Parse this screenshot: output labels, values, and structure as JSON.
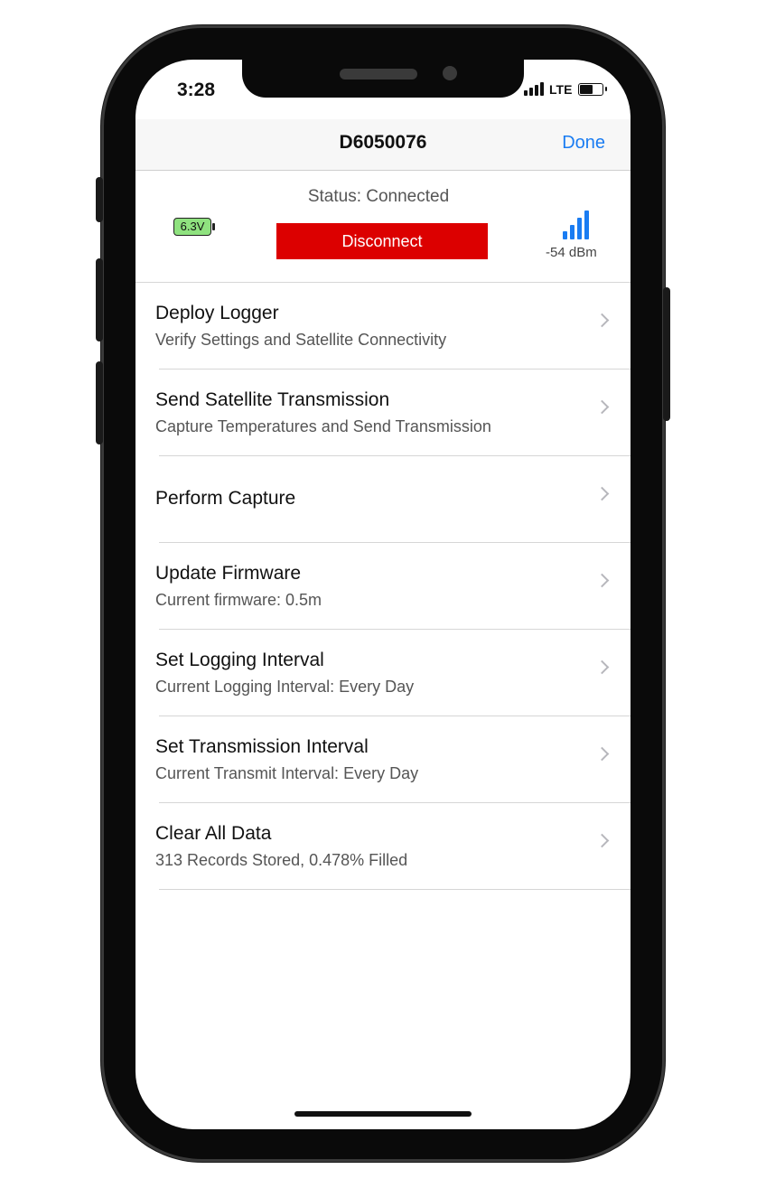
{
  "status_bar": {
    "time": "3:28",
    "network": "LTE",
    "phone_battery_level": 0.65
  },
  "nav": {
    "title": "D6050076",
    "done_label": "Done"
  },
  "device": {
    "status_text": "Status: Connected",
    "battery_label": "6.3V",
    "disconnect_label": "Disconnect",
    "signal_strength": "-54 dBm",
    "signal_icon": "signal-bars-icon"
  },
  "menu": [
    {
      "title": "Deploy Logger",
      "subtitle": "Verify Settings and Satellite Connectivity"
    },
    {
      "title": "Send Satellite Transmission",
      "subtitle": "Capture Temperatures and Send Transmission"
    },
    {
      "title": "Perform Capture",
      "subtitle": ""
    },
    {
      "title": "Update Firmware",
      "subtitle": "Current firmware: 0.5m"
    },
    {
      "title": "Set Logging Interval",
      "subtitle": "Current Logging Interval: Every Day"
    },
    {
      "title": "Set Transmission Interval",
      "subtitle": "Current Transmit Interval: Every Day"
    },
    {
      "title": "Clear All Data",
      "subtitle": "313 Records Stored, 0.478% Filled"
    }
  ],
  "colors": {
    "accent": "#1a7cf2",
    "danger": "#dc0000",
    "battery_fill": "#8fe27f"
  }
}
